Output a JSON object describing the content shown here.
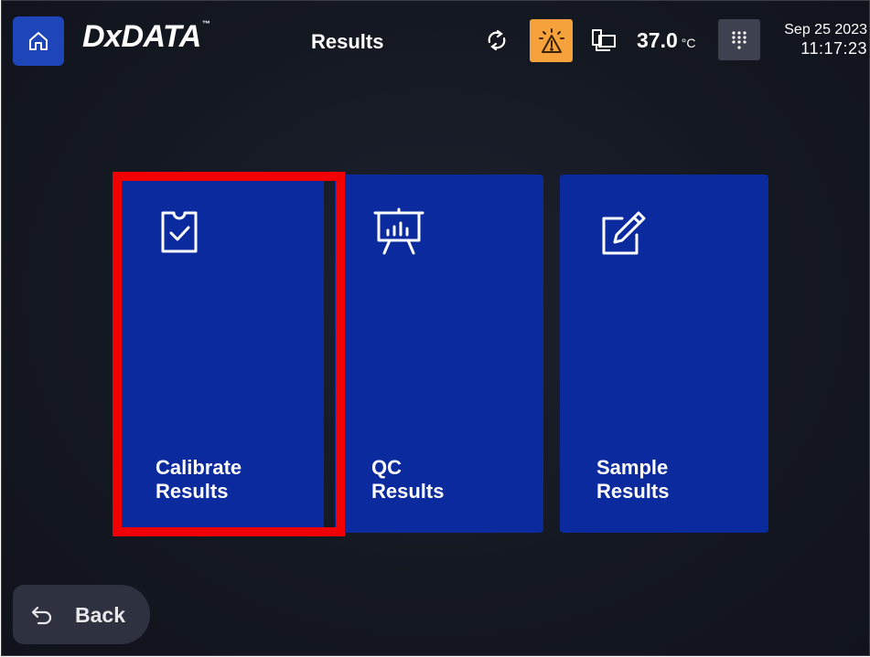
{
  "header": {
    "home_icon": "home-icon",
    "logo": "DxDATA",
    "logo_tm": "™",
    "title": "Results",
    "sync_icon": "sync-icon",
    "alert_icon": "warning-icon",
    "device_icon": "instrument-icon",
    "temperature": "37.0",
    "temperature_unit": "°C",
    "keypad_icon": "keypad-icon",
    "date": "Sep 25 2023",
    "time": "11:17:23",
    "colors": {
      "alert": "#f5a13c",
      "home": "#1f46b8"
    }
  },
  "tiles": [
    {
      "label": "Calibrate\nResults",
      "icon": "clipboard-check-icon"
    },
    {
      "label": "QC\nResults",
      "icon": "presentation-chart-icon"
    },
    {
      "label": "Sample\nResults",
      "icon": "edit-pen-icon"
    }
  ],
  "tile_color": "#0a2a9e",
  "highlight_color": "#f00000",
  "back": {
    "label": "Back",
    "icon": "back-arrow-icon"
  }
}
